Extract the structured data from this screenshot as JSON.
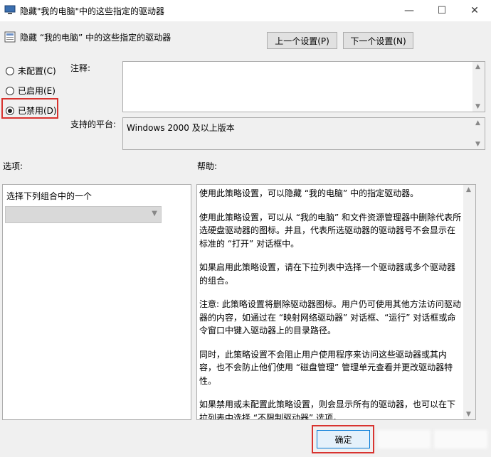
{
  "window": {
    "title": "隐藏\"我的电脑\"中的这些指定的驱动器",
    "minimize_icon": "—",
    "maximize_icon": "☐",
    "close_icon": "✕"
  },
  "header": {
    "policy_name": "隐藏 “我的电脑” 中的这些指定的驱动器",
    "prev_button": "上一个设置(P)",
    "next_button": "下一个设置(N)"
  },
  "state": {
    "options": [
      {
        "label": "未配置(C)",
        "checked": false
      },
      {
        "label": "已启用(E)",
        "checked": false
      },
      {
        "label": "已禁用(D)",
        "checked": true
      }
    ]
  },
  "comment": {
    "label": "注释:",
    "value": ""
  },
  "platform": {
    "label": "支持的平台:",
    "value": "Windows 2000 及以上版本"
  },
  "options_section": {
    "label": "选项:",
    "combo_label": "选择下列组合中的一个",
    "selected": ""
  },
  "help_section": {
    "label": "帮助:",
    "paragraphs": [
      "使用此策略设置，可以隐藏 “我的电脑” 中的指定驱动器。",
      "使用此策略设置，可以从 “我的电脑” 和文件资源管理器中删除代表所选硬盘驱动器的图标。并且，代表所选驱动器的驱动器号不会显示在标准的 “打开” 对话框中。",
      "如果启用此策略设置，请在下拉列表中选择一个驱动器或多个驱动器的组合。",
      "注意: 此策略设置将删除驱动器图标。用户仍可使用其他方法访问驱动器的内容，如通过在 “映射网络驱动器” 对话框、“运行” 对话框或命令窗口中键入驱动器上的目录路径。",
      "同时，此策略设置不会阻止用户使用程序来访问这些驱动器或其内容，也不会防止他们使用 “磁盘管理” 管理单元查看并更改驱动器特性。",
      "如果禁用或未配置此策略设置，则会显示所有的驱动器，也可以在下拉列表中选择 “不限制驱动器” 选项。"
    ]
  },
  "footer": {
    "ok_button": "确定"
  }
}
